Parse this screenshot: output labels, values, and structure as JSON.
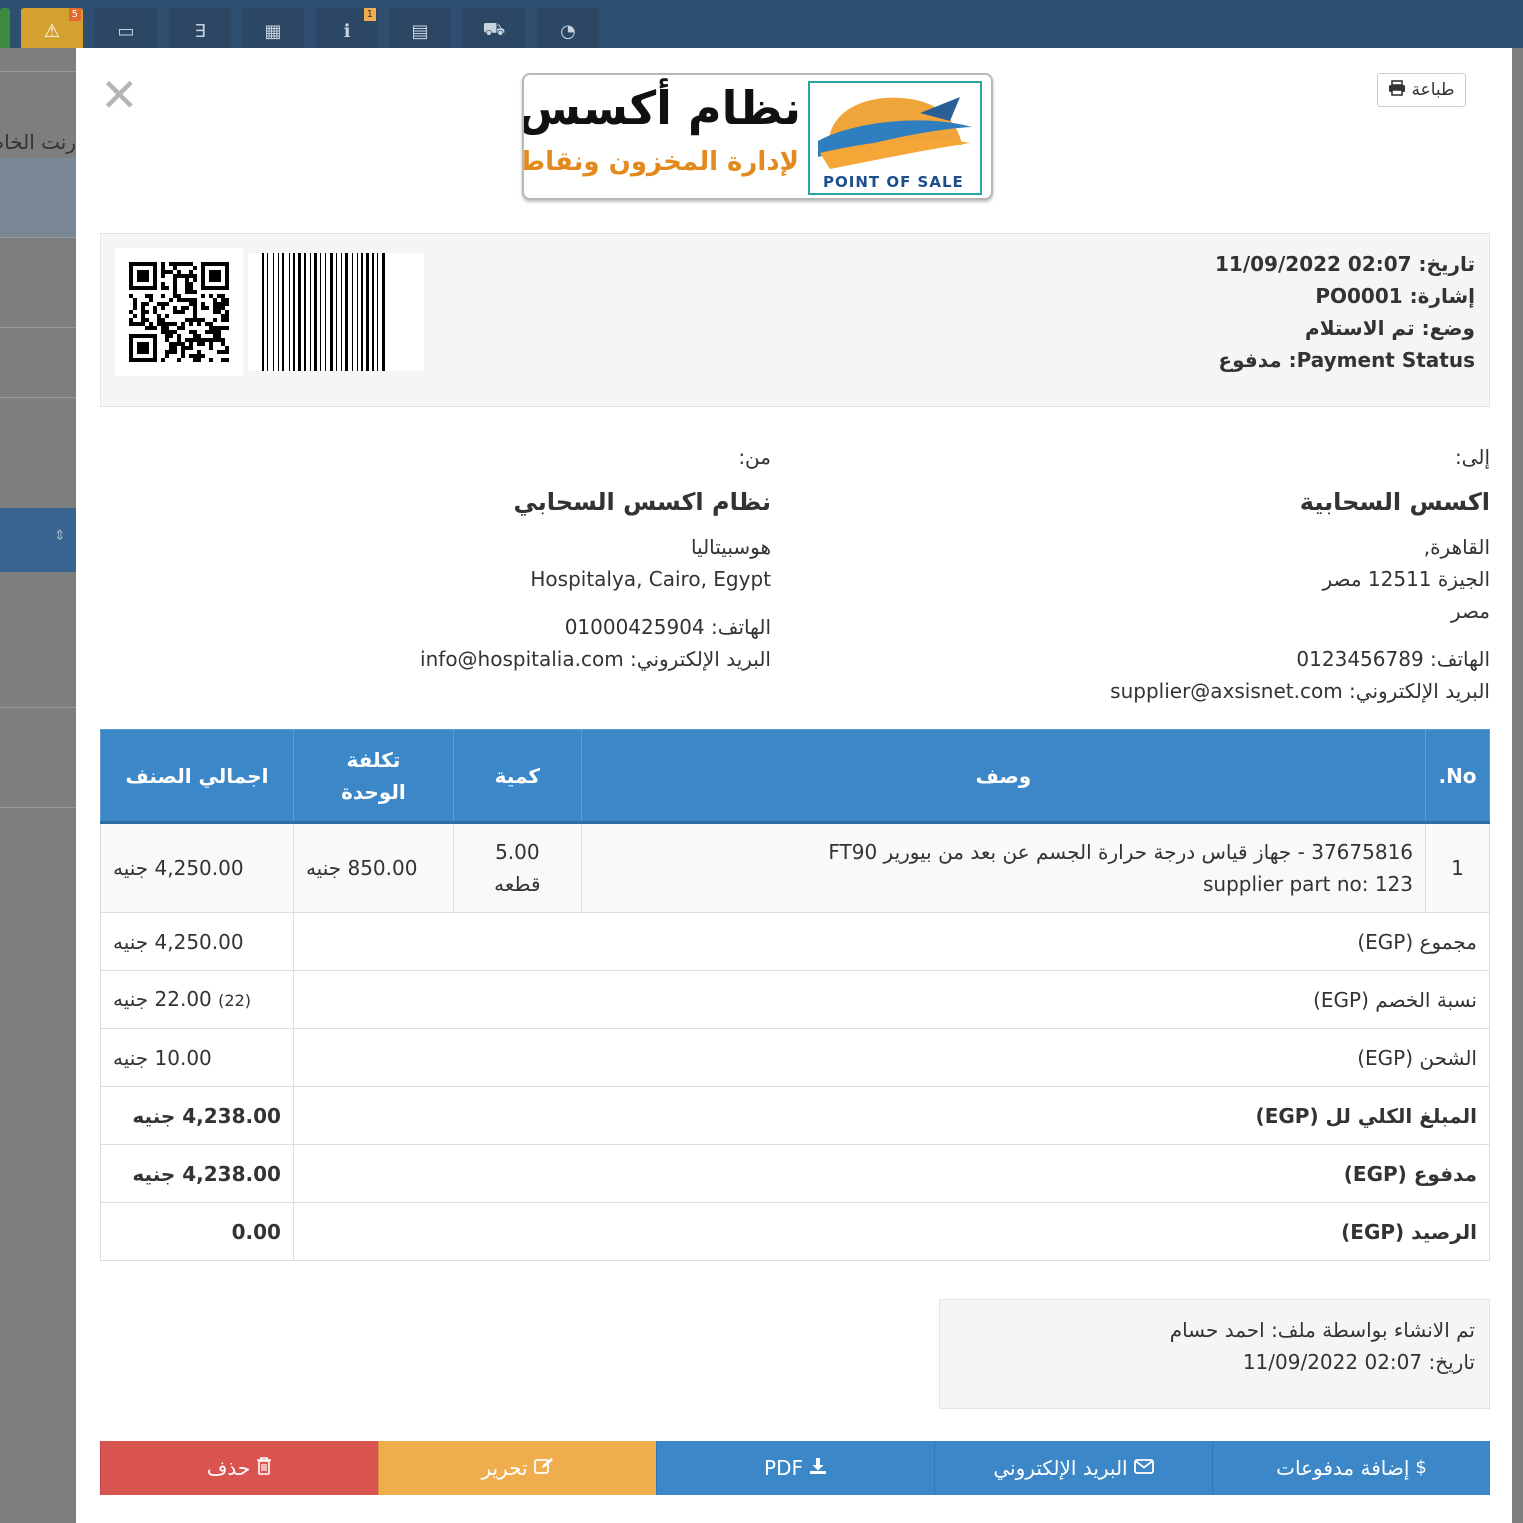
{
  "background": {
    "toolbar": [
      {
        "icon": "warning-icon",
        "glyph": "⚠",
        "badge": "5"
      },
      {
        "icon": "money-icon",
        "glyph": "▭",
        "badge": ""
      },
      {
        "icon": "css3-icon",
        "glyph": "∃",
        "badge": ""
      },
      {
        "icon": "calendar-icon",
        "glyph": "▦",
        "badge": ""
      },
      {
        "icon": "info-icon",
        "glyph": "ℹ",
        "badge": "1"
      },
      {
        "icon": "calculator-icon",
        "glyph": "▤",
        "badge": ""
      },
      {
        "icon": "cart-icon",
        "glyph": "⛟",
        "badge": ""
      },
      {
        "icon": "dashboard-icon",
        "glyph": "◔",
        "badge": ""
      }
    ],
    "partial_text": "رنت الخاص"
  },
  "modal": {
    "print_label": "طباعة",
    "logo": {
      "brand": "نظام أكسس السحابي",
      "tagline": "لإدارة المخزون ونقاط البيع",
      "pos_text": "POINT OF SALE"
    },
    "meta": {
      "date": "تاريخ: 02:07 11/09/2022",
      "reference": "إشارة: PO0001",
      "status": "وضع: تم الاستلام",
      "payment_status": "Payment Status: مدفوع"
    },
    "to": {
      "header": "إلى:",
      "name": "اكسس السحابية",
      "line1": "القاهرة,",
      "line2": "الجيزة 12511 مصر",
      "line3": "مصر",
      "phone": "الهاتف: 0123456789",
      "email": "البريد الإلكتروني: supplier@axsisnet.com"
    },
    "from": {
      "header": "من:",
      "name": "نظام اكسس السحابي",
      "line1": "هوسبيتاليا",
      "line2": "Hospitalya, Cairo, Egypt",
      "phone": "الهاتف: 01000425904",
      "email": "البريد الإلكتروني: info@hospitalia.com"
    },
    "table": {
      "headers": {
        "no": "No.",
        "description": "وصف",
        "quantity": "كمية",
        "unit_cost_1": "تكلفة",
        "unit_cost_2": "الوحدة",
        "subtotal": "اجمالي الصنف"
      },
      "items": [
        {
          "no": "1",
          "description": "37675816 - جهاز قياس درجة حرارة الجسم عن بعد من بيورير FT90",
          "supplier_part": "supplier part no: 123",
          "quantity": "5.00",
          "unit": "قطعه",
          "unit_cost": "850.00 جنيه",
          "subtotal": "4,250.00 جنيه"
        }
      ],
      "totals": {
        "total_label": "مجموع (EGP)",
        "total_value": "4,250.00 جنيه",
        "discount_label": "نسبة الخصم (EGP)",
        "discount_pct": "(22)",
        "discount_value": "22.00 جنيه",
        "shipping_label": "الشحن (EGP)",
        "shipping_value": "10.00 جنيه",
        "grand_label": "المبلغ الكلي لل (EGP)",
        "grand_value": "4,238.00 جنيه",
        "paid_label": "مدفوع (EGP)",
        "paid_value": "4,238.00 جنيه",
        "balance_label": "الرصيد (EGP)",
        "balance_value": "0.00"
      }
    },
    "created": {
      "by": "تم الانشاء بواسطة ملف: احمد حسام",
      "date": "تاريخ: 02:07 11/09/2022"
    },
    "actions": {
      "add_payment": "إضافة مدفوعات",
      "email": "البريد الإلكتروني",
      "pdf": "PDF",
      "edit": "تحرير",
      "delete": "حذف"
    },
    "colors": {
      "primary": "#3c87c8",
      "warning": "#f0ad4e",
      "danger": "#d9534f"
    }
  }
}
